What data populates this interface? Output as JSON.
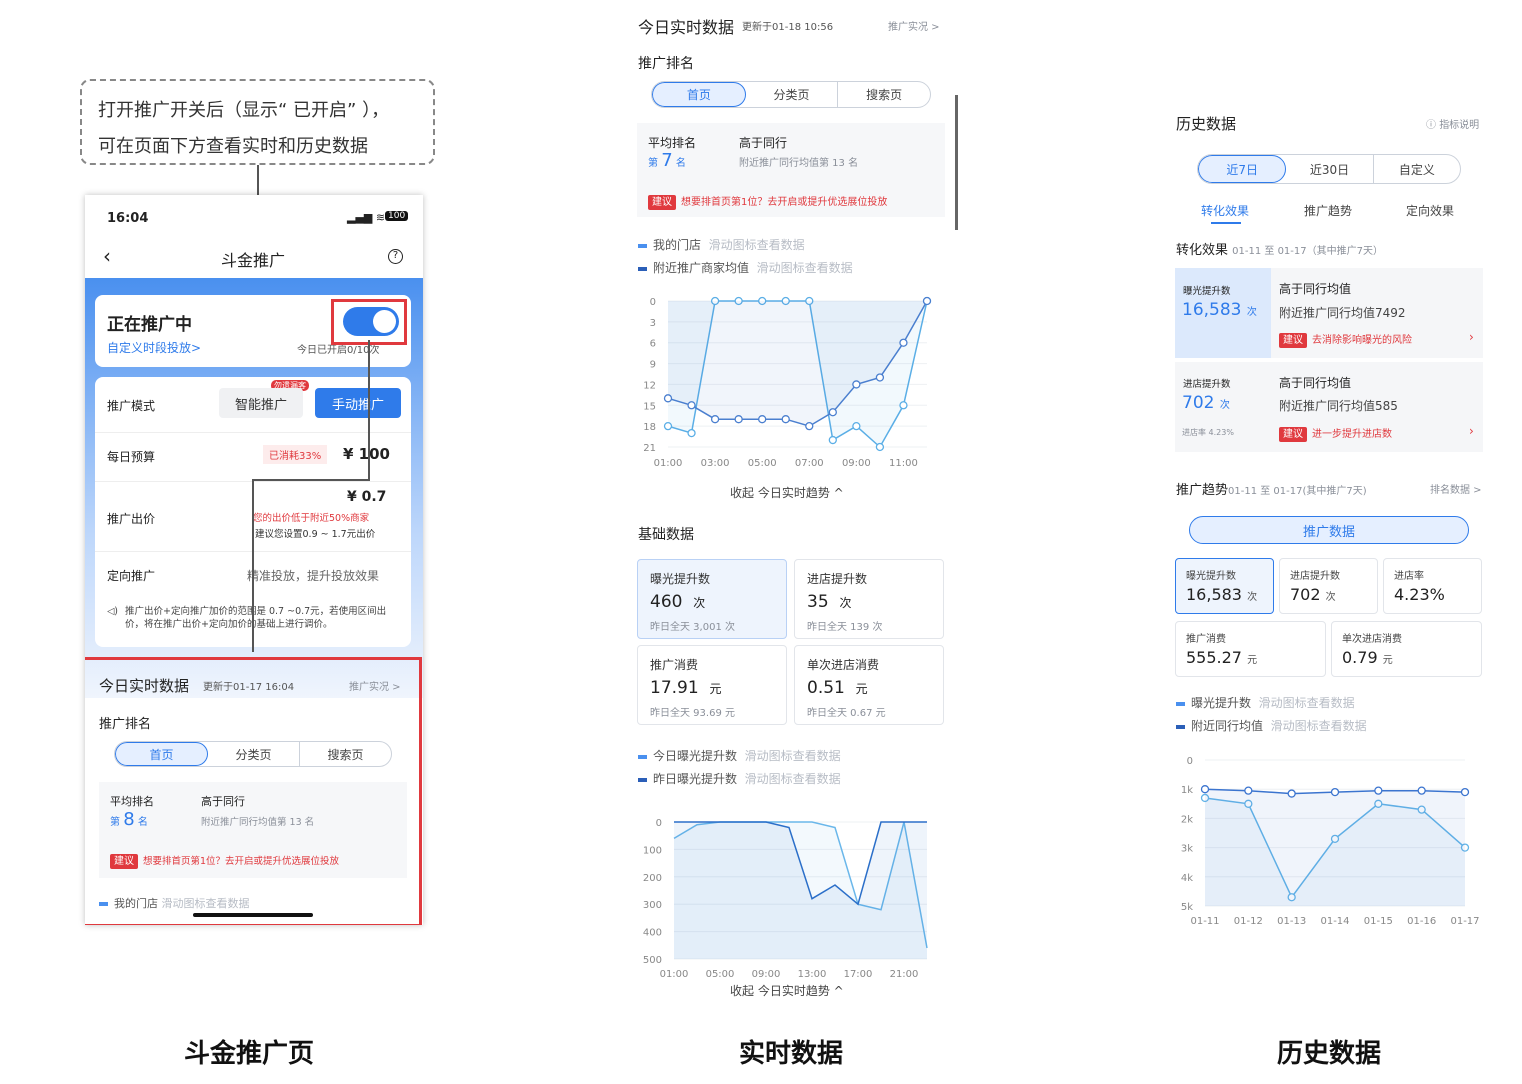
{
  "callout": {
    "line1": "打开推广开关后（显示“ 已开启” ），",
    "line2": "可在页面下方查看实时和历史数据"
  },
  "phone": {
    "status_time": "16:04",
    "battery": "100",
    "nav_title": "斗金推广",
    "promo_status": "正在推广中",
    "custom_slot": "自定义时段投放>",
    "today_on": "今日已开启0/10次",
    "mode_label": "推广模式",
    "mode_badge": "勿遗漏客",
    "mode_smart": "智能推广",
    "mode_manual": "手动推广",
    "budget_label": "每日预算",
    "budget_used": "已消耗33%",
    "budget_value": "¥ 100",
    "bid_label": "推广出价",
    "bid_value": "¥ 0.7",
    "bid_warn": "您的出价低于附近50%商家",
    "bid_suggest": "建议您设置0.9 ~ 1.7元出价",
    "target_label": "定向推广",
    "target_desc": "精准投放，提升投放效果",
    "note": "推广出价+定向推广加价的范围是 0.7 ~0.7元，若使用区间出价，将在推广出价+定向加价的基础上进行调价。",
    "rt_title": "今日实时数据",
    "rt_update": "更新于01-17 16:04",
    "rt_link": "推广实况 >",
    "rank_title": "推广排名",
    "tabs": [
      "首页",
      "分类页",
      "搜索页"
    ],
    "avg_rank_label": "平均排名",
    "rank_prefix": "第",
    "rank_num": "8",
    "rank_suffix": "名",
    "peer_title": "高于同行",
    "peer_desc": "附近推广同行均值第 13 名",
    "tip_tag": "建议",
    "tip_text": "想要排首页第1位？去开启或提升优选展位投放",
    "leg1": "我的门店",
    "leg1_hint": "滑动图标查看数据",
    "leg2": "附近推广商家均值",
    "leg2_hint": "滑动图标查看数据"
  },
  "realtime": {
    "title": "今日实时数据",
    "update": "更新于01-18 10:56",
    "link": "推广实况 >",
    "rank_title": "推广排名",
    "tabs": [
      "首页",
      "分类页",
      "搜索页"
    ],
    "avg_rank_label": "平均排名",
    "rank_prefix": "第",
    "rank_num": "7",
    "rank_suffix": "名",
    "peer_title": "高于同行",
    "peer_desc": "附近推广同行均值第 13 名",
    "tip_tag": "建议",
    "tip_text": "想要排首页第1位？去开启或提升优选展位投放",
    "leg1": "我的门店",
    "leg1_hint": "滑动图标查看数据",
    "leg2": "附近推广商家均值",
    "leg2_hint": "滑动图标查看数据",
    "collapse": "收起 今日实时趋势 ^",
    "basic_title": "基础数据",
    "metrics": [
      {
        "label": "曝光提升数",
        "value": "460",
        "unit": "次",
        "prev": "昨日全天  3,001 次"
      },
      {
        "label": "进店提升数",
        "value": "35",
        "unit": "次",
        "prev": "昨日全天  139 次"
      },
      {
        "label": "推广消费",
        "value": "17.91",
        "unit": "元",
        "prev": "昨日全天  93.69 元"
      },
      {
        "label": "单次进店消费",
        "value": "0.51",
        "unit": "元",
        "prev": "昨日全天  0.67 元"
      }
    ],
    "leg3": "今日曝光提升数",
    "leg3_hint": "滑动图标查看数据",
    "leg4": "昨日曝光提升数",
    "leg4_hint": "滑动图标查看数据",
    "collapse2": "收起 今日实时趋势 ^"
  },
  "history": {
    "title": "历史数据",
    "help": "指标说明",
    "ranges": [
      "近7日",
      "近30日",
      "自定义"
    ],
    "subtabs": [
      "转化效果",
      "推广趋势",
      "定向效果"
    ],
    "conv_title": "转化效果",
    "conv_range": "01-11 至 01-17（其中推广7天）",
    "exp_label": "曝光提升数",
    "exp_value": "16,583",
    "exp_unit": "次",
    "exp_peer": "高于同行均值",
    "exp_peer_desc": "附近推广同行均值7492",
    "exp_tip": "去消除影响曝光的风险",
    "shop_label": "进店提升数",
    "shop_value": "702",
    "shop_unit": "次",
    "shop_rate": "进店率 4.23%",
    "shop_peer": "高于同行均值",
    "shop_peer_desc": "附近推广同行均值585",
    "shop_tip": "进一步提升进店数",
    "tip_tag": "建议",
    "trend_title": "推广趋势",
    "trend_range": "01-11 至 01-17(其中推广7天)",
    "trend_link": "排名数据 >",
    "trend_btn": "推广数据",
    "cells": [
      {
        "label": "曝光提升数",
        "value": "16,583",
        "unit": "次"
      },
      {
        "label": "进店提升数",
        "value": "702",
        "unit": "次"
      },
      {
        "label": "进店率",
        "value": "4.23%",
        "unit": ""
      },
      {
        "label": "推广消费",
        "value": "555.27",
        "unit": "元"
      },
      {
        "label": "单次进店消费",
        "value": "0.79",
        "unit": "元"
      }
    ],
    "leg1": "曝光提升数",
    "leg1_hint": "滑动图标查看数据",
    "leg2": "附近同行均值",
    "leg2_hint": "滑动图标查看数据"
  },
  "captions": [
    "斗金推广页",
    "实时数据",
    "历史数据"
  ],
  "chart_data": [
    {
      "type": "line",
      "title": "",
      "x": [
        "01:00",
        "02:00",
        "03:00",
        "04:00",
        "05:00",
        "06:00",
        "07:00",
        "08:00",
        "09:00",
        "10:00",
        "11:00",
        "12:00"
      ],
      "xticks": [
        "01:00",
        "03:00",
        "05:00",
        "07:00",
        "09:00",
        "11:00"
      ],
      "yticks": [
        "0",
        "3",
        "6",
        "9",
        "12",
        "15",
        "18",
        "21"
      ],
      "ylim": [
        21,
        0
      ],
      "series": [
        {
          "name": "我的门店",
          "values": [
            3,
            2,
            21,
            21,
            21,
            21,
            21,
            1,
            3,
            0,
            6,
            21
          ]
        },
        {
          "name": "附近推广商家均值",
          "values": [
            7,
            6,
            4,
            4,
            4,
            4,
            3,
            5,
            9,
            10,
            15,
            21
          ]
        }
      ]
    },
    {
      "type": "area",
      "title": "",
      "x": [
        "01:00",
        "03:00",
        "05:00",
        "07:00",
        "09:00",
        "11:00",
        "13:00",
        "15:00",
        "17:00",
        "19:00",
        "21:00",
        "23:00"
      ],
      "xticks": [
        "01:00",
        "05:00",
        "09:00",
        "13:00",
        "17:00",
        "21:00"
      ],
      "yticks": [
        "0",
        "100",
        "200",
        "300",
        "400",
        "500"
      ],
      "ylim": [
        0,
        500
      ],
      "series": [
        {
          "name": "今日曝光提升数",
          "values": [
            60,
            10,
            0,
            0,
            0,
            0,
            0,
            20,
            300,
            320,
            0,
            460
          ]
        },
        {
          "name": "昨日曝光提升数",
          "values": [
            0,
            0,
            0,
            0,
            0,
            20,
            280,
            230,
            300,
            0,
            0,
            0
          ]
        }
      ]
    },
    {
      "type": "line",
      "title": "",
      "x": [
        "01-11",
        "01-12",
        "01-13",
        "01-14",
        "01-15",
        "01-16",
        "01-17"
      ],
      "yticks": [
        "0",
        "1k",
        "2k",
        "3k",
        "4k",
        "5k"
      ],
      "ylim": [
        0,
        5000
      ],
      "series": [
        {
          "name": "曝光提升数",
          "values": [
            1300,
            1500,
            4700,
            2700,
            1500,
            1700,
            3000
          ]
        },
        {
          "name": "附近同行均值",
          "values": [
            1000,
            1050,
            1150,
            1100,
            1050,
            1050,
            1100
          ]
        }
      ]
    }
  ]
}
